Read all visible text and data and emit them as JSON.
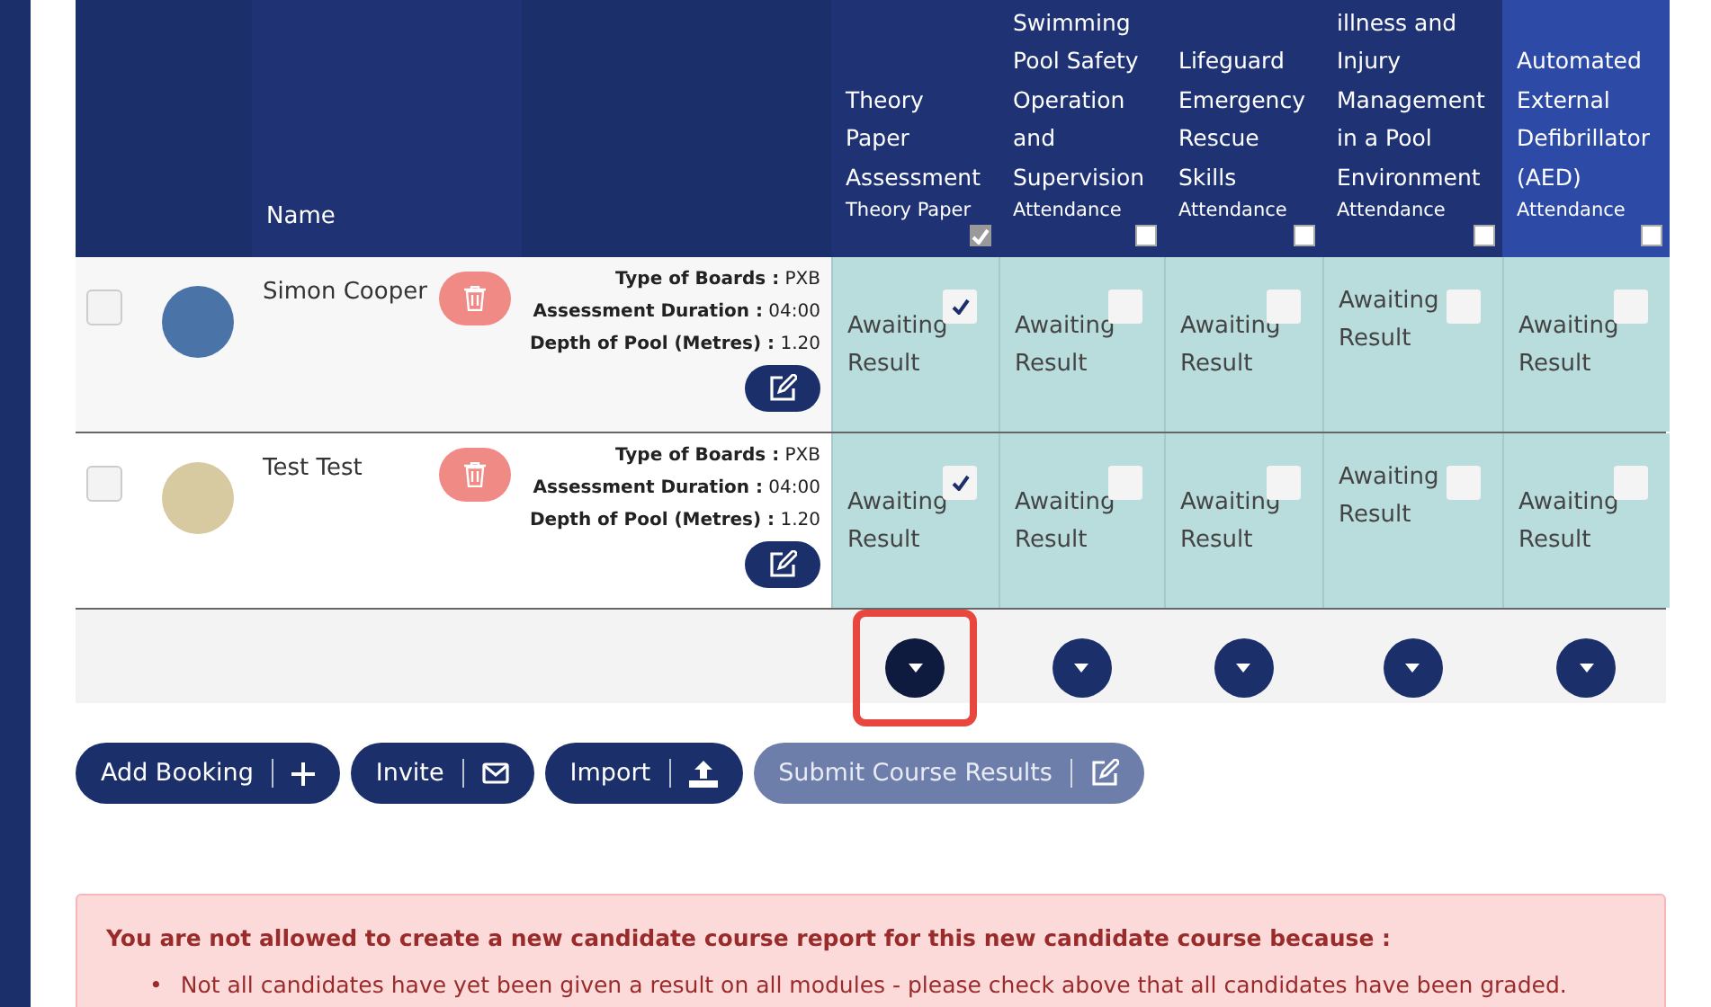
{
  "table": {
    "columns": [
      {
        "label": "Name"
      }
    ],
    "modules": [
      {
        "lines": [
          "Theory",
          "Paper",
          "Assessment"
        ],
        "sub": "Theory Paper",
        "checked": true,
        "disabled": true,
        "highlighted": false
      },
      {
        "lines": [
          "Swimming",
          "Pool Safety",
          "Operation",
          "and",
          "Supervision"
        ],
        "sub": "Attendance",
        "checked": false,
        "disabled": false,
        "highlighted": false
      },
      {
        "lines": [
          "Lifeguard",
          "Emergency",
          "Rescue",
          "Skills"
        ],
        "sub": "Attendance",
        "checked": false,
        "disabled": false,
        "highlighted": false
      },
      {
        "lines": [
          "illness and",
          "Injury",
          "Management",
          "in a Pool",
          "Environment"
        ],
        "sub": "Attendance",
        "checked": false,
        "disabled": false,
        "highlighted": false
      },
      {
        "lines": [
          "Automated",
          "External",
          "Defibrillator",
          "(AED)"
        ],
        "sub": "Attendance",
        "checked": false,
        "disabled": false,
        "highlighted": true
      }
    ],
    "rows": [
      {
        "name": "Simon Cooper",
        "kind": "photo",
        "checked": false,
        "info": [
          "**Type of Boards :** PXB",
          "**Assessment Duration :** 04:00",
          "**Depth of Pool (Metres) :** 1.20"
        ],
        "results": [
          {
            "text": "Awaiting Result",
            "checked": true
          },
          {
            "text": "Awaiting Result",
            "checked": false
          },
          {
            "text": "Awaiting Result",
            "checked": false
          },
          {
            "text": "Awaiting Result",
            "checked": false
          },
          {
            "text": "Awaiting Result",
            "checked": false
          }
        ]
      },
      {
        "name": "Test Test",
        "kind": "pattern",
        "checked": false,
        "info": [
          "**Type of Boards :** PXB",
          "**Assessment Duration :** 04:00",
          "**Depth of Pool (Metres) :** 1.20"
        ],
        "results": [
          {
            "text": "Awaiting Result",
            "checked": true
          },
          {
            "text": "Awaiting Result",
            "checked": false
          },
          {
            "text": "Awaiting Result",
            "checked": false
          },
          {
            "text": "Awaiting Result",
            "checked": false
          },
          {
            "text": "Awaiting Result",
            "checked": false
          }
        ]
      }
    ],
    "dropdowns": [
      {
        "selected": true
      },
      {
        "selected": false
      },
      {
        "selected": false
      },
      {
        "selected": false
      },
      {
        "selected": false
      }
    ]
  },
  "buttons": [
    {
      "label": "Add Booking",
      "disabled": false
    },
    {
      "label": "Invite",
      "disabled": false
    },
    {
      "label": "Import",
      "disabled": false
    },
    {
      "label": "Submit Course Results",
      "disabled": true
    }
  ],
  "alert": {
    "title": "You are not allowed to create a new candidate course report for this new candidate course because :",
    "items": [
      {
        "marker": "•",
        "text": "Not all candidates have yet been given a result on all modules - please check above that all candidates have been graded."
      }
    ]
  }
}
